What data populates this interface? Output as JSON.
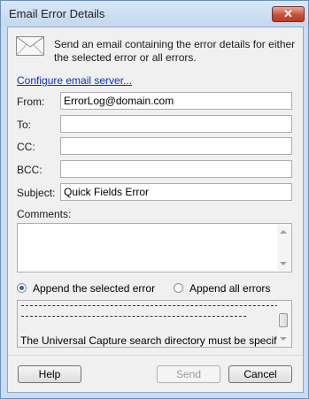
{
  "window": {
    "title": "Email Error Details",
    "close_glyph": "✕"
  },
  "description": "Send an email containing the error details for either the selected error or all errors.",
  "configure_link": "Configure email server...",
  "form": {
    "from_label": "From:",
    "from_value": "ErrorLog@domain.com",
    "to_label": "To:",
    "to_value": "",
    "cc_label": "CC:",
    "cc_value": "",
    "bcc_label": "BCC:",
    "bcc_value": "",
    "subject_label": "Subject:",
    "subject_value": "Quick Fields Error",
    "comments_label": "Comments:",
    "comments_value": ""
  },
  "append": {
    "selected_label": "Append the selected error",
    "all_label": "Append all errors",
    "selected": "selected"
  },
  "error_preview": {
    "text": "The Universal Capture search directory must be specified."
  },
  "buttons": {
    "help": "Help",
    "send": "Send",
    "cancel": "Cancel"
  },
  "icons": {
    "message": "envelope-icon",
    "close": "close-icon",
    "scroll_up": "scroll-up-icon",
    "scroll_down": "scroll-down-icon"
  }
}
